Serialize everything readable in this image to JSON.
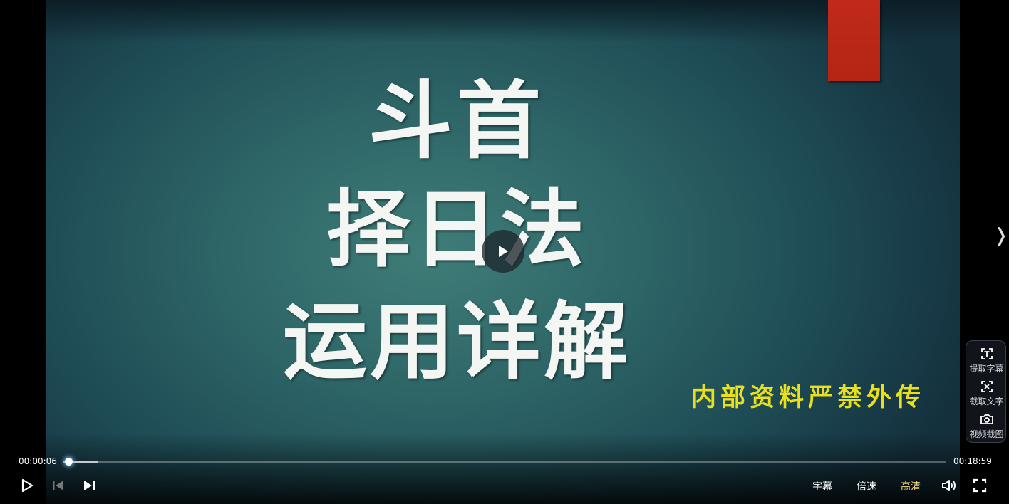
{
  "video": {
    "title_lines": [
      "斗首",
      "择日法",
      "运用详解"
    ],
    "notice": "内部资料严禁外传",
    "accent_red": "#c02a1a",
    "notice_color": "#e8e01c"
  },
  "player": {
    "current_time": "00:00:06",
    "total_time": "00:18:59",
    "progress": 0.0053,
    "subtitle_label": "字幕",
    "speed_label": "倍速",
    "quality_label": "高清",
    "quality_color": "#f0d27a"
  },
  "side_tools": [
    {
      "label": "提取字幕",
      "icon": "text-extract-icon"
    },
    {
      "label": "截取文字",
      "icon": "text-capture-icon"
    },
    {
      "label": "视频截图",
      "icon": "camera-icon"
    }
  ],
  "side_arrow": "❭"
}
